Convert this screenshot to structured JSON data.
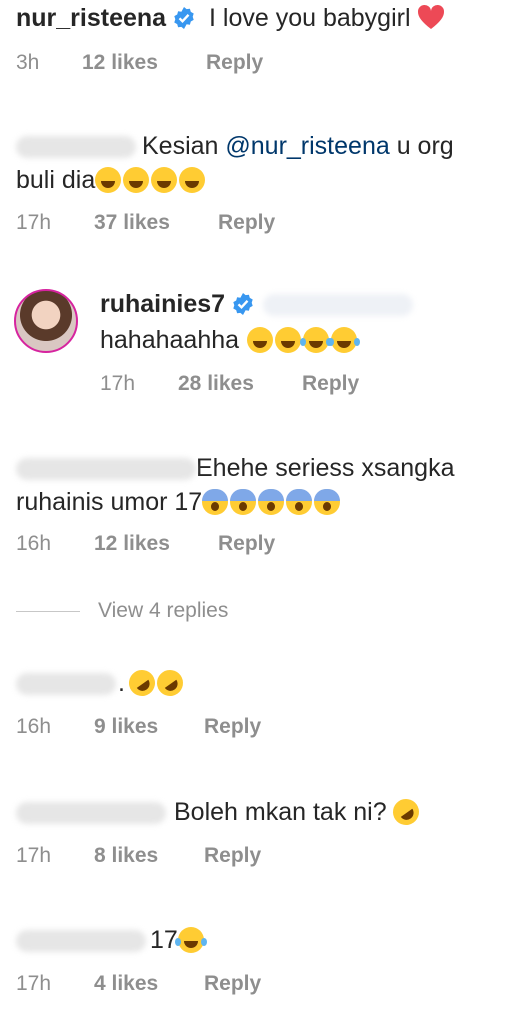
{
  "comments": [
    {
      "username": "nur_risteena",
      "verified": true,
      "text": "I love you babygirl",
      "time": "3h",
      "likes": "12 likes",
      "reply": "Reply"
    },
    {
      "text_part1": "Kesian ",
      "mention": "@nur_risteena",
      "text_part2": " u org",
      "line2": "buli dia",
      "time": "17h",
      "likes": "37 likes",
      "reply": "Reply"
    },
    {
      "username": "ruhainies7",
      "verified": true,
      "text": "hahahaahha",
      "time": "17h",
      "likes": "28 likes",
      "reply": "Reply"
    },
    {
      "text_line1": "Ehehe seriess xsangka",
      "text_line2": "ruhainis umor 17",
      "time": "16h",
      "likes": "12 likes",
      "reply": "Reply"
    },
    {
      "text": ".",
      "time": "16h",
      "likes": "9 likes",
      "reply": "Reply"
    },
    {
      "text": "Boleh mkan tak ni?",
      "time": "17h",
      "likes": "8 likes",
      "reply": "Reply"
    },
    {
      "text": "17",
      "time": "17h",
      "likes": "4 likes",
      "reply": "Reply"
    }
  ],
  "view_replies": "View 4 replies",
  "colors": {
    "text": "#262626",
    "meta": "#8e8e8e",
    "mention": "#00376b",
    "verified": "#3897f0",
    "heart": "#ed4956"
  },
  "icons": [
    "verified-badge-icon",
    "heart-icon",
    "laughing-emoji-icon",
    "tongue-emoji-icon",
    "tears-of-joy-emoji-icon",
    "screaming-emoji-icon",
    "rofl-emoji-icon"
  ]
}
